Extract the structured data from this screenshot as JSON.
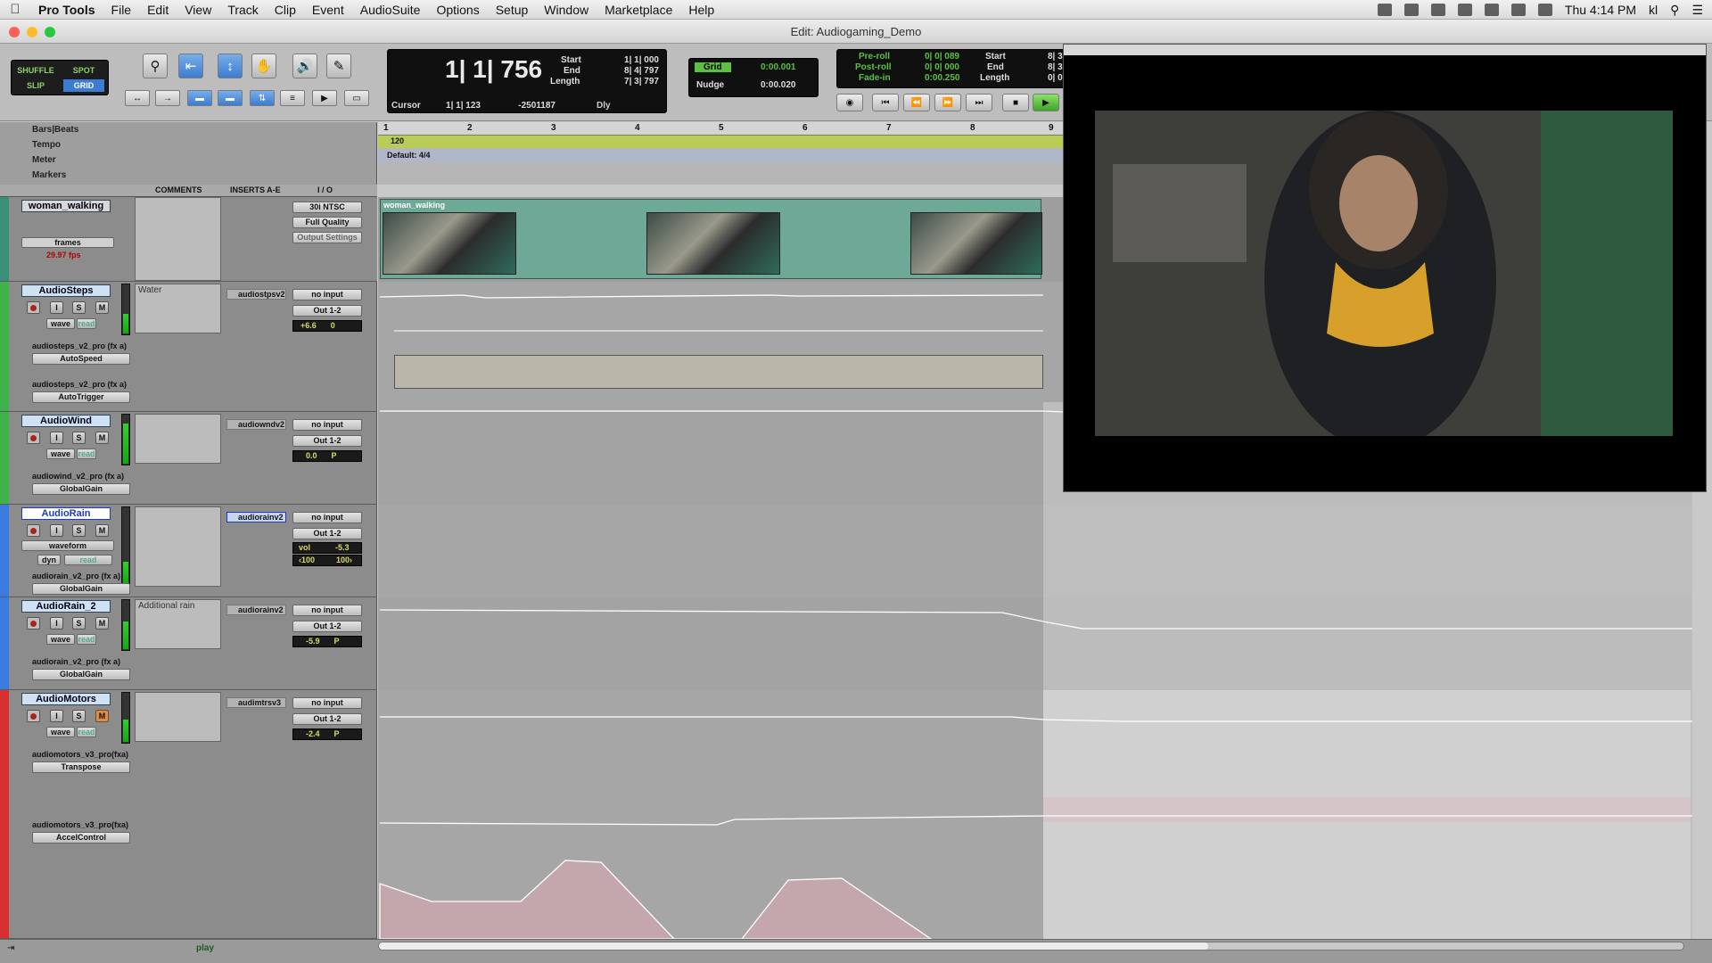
{
  "menubar": {
    "app": "Pro Tools",
    "items": [
      "File",
      "Edit",
      "View",
      "Track",
      "Clip",
      "Event",
      "AudioSuite",
      "Options",
      "Setup",
      "Window",
      "Marketplace",
      "Help"
    ],
    "clock": "Thu 4:14 PM",
    "user": "kl"
  },
  "window": {
    "title": "Edit: Audiogaming_Demo"
  },
  "edit_modes": {
    "shuffle": "SHUFFLE",
    "spot": "SPOT",
    "slip": "SLIP",
    "grid": "GRID",
    "selected": "GRID"
  },
  "counter": {
    "main": "1| 1| 756",
    "start_label": "Start",
    "start_value": "1| 1| 000",
    "end_label": "End",
    "end_value": "8| 4| 797",
    "length_label": "Length",
    "length_value": "7| 3| 797",
    "cursor_label": "Cursor",
    "cursor_value": "1| 1| 123",
    "cursor_sample": "-2501187",
    "dly_label": "Dly"
  },
  "grid": {
    "grid_label": "Grid",
    "grid_value": "0:00.001",
    "nudge_label": "Nudge",
    "nudge_value": "0:00.020"
  },
  "preroll": {
    "preroll_label": "Pre-roll",
    "preroll_value": "0| 0| 089",
    "postroll_label": "Post-roll",
    "postroll_value": "0| 0| 000",
    "fadein_label": "Fade-in",
    "fadein_value": "0:00.250",
    "start_label": "Start",
    "end_label": "End",
    "length_label": "Length",
    "start_value": "8| 3",
    "end_value": "8| 3",
    "length_value": "0| 0"
  },
  "rulers": {
    "barsbeats": "Bars|Beats",
    "tempo": "Tempo",
    "meter": "Meter",
    "markers": "Markers",
    "tempo_value": "120",
    "meter_value": "Default: 4/4",
    "bar_numbers": [
      "1",
      "2",
      "3",
      "4",
      "5",
      "6",
      "7",
      "8",
      "9"
    ]
  },
  "columns": {
    "comments": "COMMENTS",
    "inserts": "INSERTS A-E",
    "io": "I / O"
  },
  "video_track": {
    "name": "woman_walking",
    "format": "30i NTSC",
    "quality": "Full Quality",
    "output_settings": "Output Settings",
    "view": "frames",
    "fps": "29.97 fps",
    "clip_name": "woman_walking"
  },
  "tracks": [
    {
      "name": "AudioSteps",
      "comment": "Water",
      "insert": "audiostpsv2",
      "input": "no input",
      "output": "Out 1-2",
      "vol": "+6.6",
      "pan": "0",
      "plugins": [
        {
          "name": "audiosteps_v2_pro (fx a)",
          "param": "AutoSpeed"
        },
        {
          "name": "audiosteps_v2_pro (fx a)",
          "param": "AutoTrigger"
        }
      ],
      "view": "wave",
      "auto": "read",
      "color": "#3fb24a"
    },
    {
      "name": "AudioWind",
      "comment": "",
      "insert": "audiowndv2",
      "input": "no input",
      "output": "Out 1-2",
      "vol": "0.0",
      "pan": "P",
      "plugins": [
        {
          "name": "audiowind_v2_pro (fx a)",
          "param": "GlobalGain"
        }
      ],
      "view": "wave",
      "auto": "read",
      "color": "#3fb24a"
    },
    {
      "name": "AudioRain",
      "comment": "",
      "insert": "audiorainv2",
      "input": "no input",
      "output": "Out 1-2",
      "vol": "-5.3",
      "pan": "100",
      "vol_label": "vol",
      "pan_left": "‹100",
      "pan_right": "100›",
      "plugins": [
        {
          "name": "audiorain_v2_pro (fx a)",
          "param": "GlobalGain"
        }
      ],
      "view": "waveform",
      "auto": "read",
      "dyn": "dyn",
      "color": "#3b7be0"
    },
    {
      "name": "AudioRain_2",
      "comment": "Additional rain",
      "insert": "audiorainv2",
      "input": "no input",
      "output": "Out 1-2",
      "vol": "-5.9",
      "pan": "P",
      "plugins": [
        {
          "name": "audiorain_v2_pro (fx a)",
          "param": "GlobalGain"
        }
      ],
      "view": "wave",
      "auto": "read",
      "color": "#3b7be0"
    },
    {
      "name": "AudioMotors",
      "comment": "",
      "insert": "audimtrsv3",
      "input": "no input",
      "output": "Out 1-2",
      "vol": "-2.4",
      "pan": "P",
      "plugins": [
        {
          "name": "audiomotors_v3_pro(fxa)",
          "param": "Transpose"
        },
        {
          "name": "audiomotors_v3_pro(fxa)",
          "param": "AccelControl"
        }
      ],
      "view": "wave",
      "auto": "read",
      "color": "#d83030"
    }
  ],
  "status": {
    "transport_state": "play"
  },
  "colors": {
    "tempo_ruler": "#b8cc57",
    "video_clip": "#6ea998",
    "selection": "#3c7bd2",
    "motors": "#d83030"
  }
}
